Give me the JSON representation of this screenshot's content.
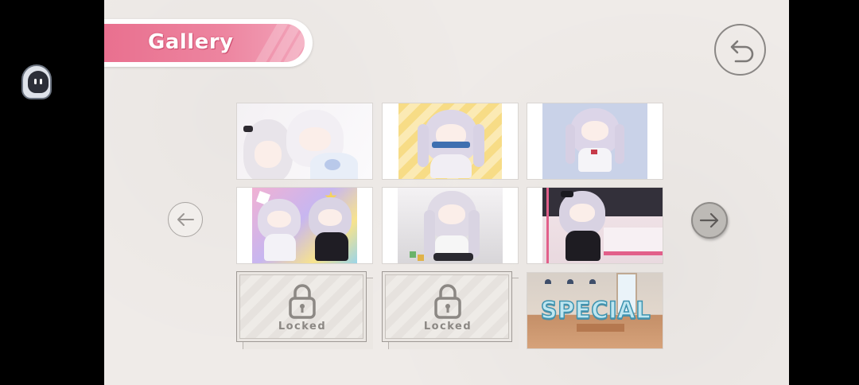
{
  "header": {
    "title": "Gallery"
  },
  "navigation": {
    "back_icon": "undo-arrow-icon",
    "prev_icon": "arrow-left-icon",
    "next_icon": "arrow-right-icon"
  },
  "gallery": {
    "items": [
      {
        "name": "two-girls-embrace-artwork",
        "status": "unlocked"
      },
      {
        "name": "girl-with-game-console-yellow-stripes",
        "status": "unlocked"
      },
      {
        "name": "girl-standing-blue-background",
        "status": "unlocked"
      },
      {
        "name": "two-girls-colorful-party",
        "status": "unlocked"
      },
      {
        "name": "girl-sitting-toys",
        "status": "unlocked"
      },
      {
        "name": "girl-in-black-dress-bedroom",
        "status": "unlocked"
      },
      {
        "name": "locked-slot-1",
        "status": "locked",
        "label": "Locked"
      },
      {
        "name": "locked-slot-2",
        "status": "locked",
        "label": "Locked"
      },
      {
        "name": "special-room-scene",
        "status": "special",
        "label": "SPECIAL"
      }
    ]
  },
  "colors": {
    "banner_pink": "#e9708f",
    "background": "#efebe8",
    "special_text": "#bfe6f0",
    "special_outline": "#3d93b0"
  }
}
